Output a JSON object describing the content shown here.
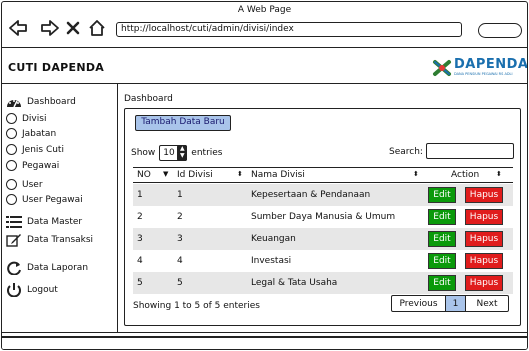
{
  "window": {
    "title": "A Web Page",
    "url": "http://localhost/cuti/admin/divisi/index"
  },
  "app": {
    "title": "CUTI DAPENDA",
    "logo_text": "DAPENDA",
    "logo_sub": "DANA PENSIUN PEGAWAI RS ADLI"
  },
  "sidebar": {
    "dashboard": "Dashboard",
    "items": [
      "Divisi",
      "Jabatan",
      "Jenis Cuti",
      "Pegawai",
      "User",
      "User Pegawai"
    ],
    "data_master": "Data Master",
    "data_transaksi": "Data Transaksi",
    "data_laporan": "Data Laporan",
    "logout": "Logout"
  },
  "main": {
    "breadcrumb": "Dashboard",
    "add_button": "Tambah Data Baru",
    "show_label": "Show",
    "entries_value": "10",
    "entries_label": "entries",
    "search_label": "Search:",
    "columns": [
      "NO",
      "Id Divisi",
      "Nama Divisi",
      "Action"
    ],
    "rows": [
      {
        "no": "1",
        "id": "1",
        "nama": "Kepesertaan & Pendanaan"
      },
      {
        "no": "2",
        "id": "2",
        "nama": "Sumber Daya Manusia & Umum"
      },
      {
        "no": "3",
        "id": "3",
        "nama": "Keuangan"
      },
      {
        "no": "4",
        "id": "4",
        "nama": "Investasi"
      },
      {
        "no": "5",
        "id": "5",
        "nama": "Legal & Tata Usaha"
      }
    ],
    "edit_label": "Edit",
    "delete_label": "Hapus",
    "info": "Showing 1 to 5 of 5 enteries",
    "pager": {
      "prev": "Previous",
      "current": "1",
      "next": "Next"
    }
  },
  "colors": {
    "accent": "#a9c4ea",
    "edit": "#0a9a0a",
    "delete": "#e01c1c",
    "logo": "#1a6fae"
  }
}
